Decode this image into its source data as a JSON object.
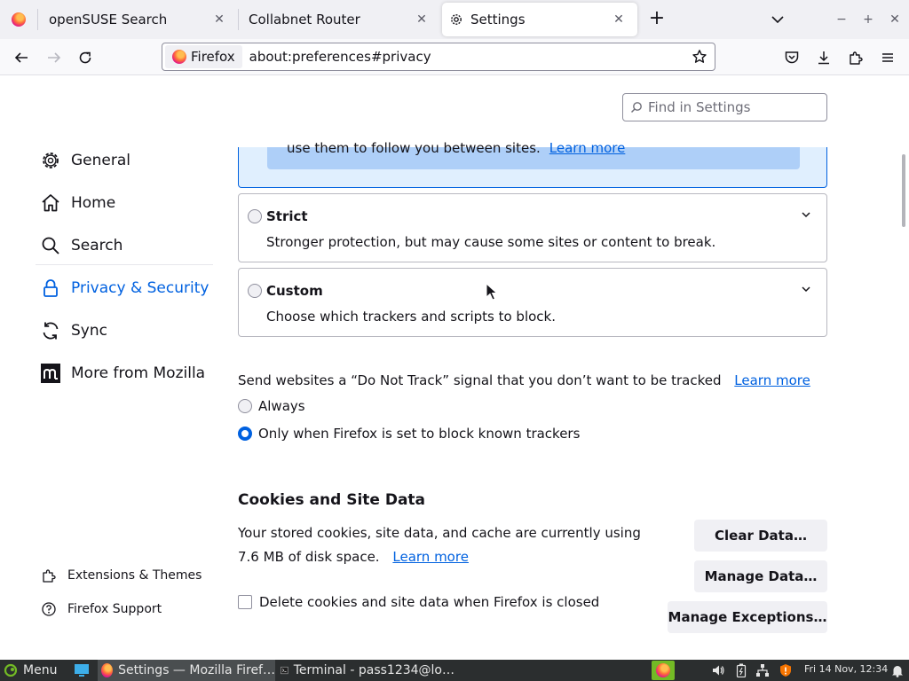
{
  "tabs": [
    {
      "title": "openSUSE Search",
      "active": false
    },
    {
      "title": "Collabnet Router",
      "active": false
    },
    {
      "title": "Settings",
      "active": true
    }
  ],
  "urlbar": {
    "identity": "Firefox",
    "url": "about:preferences#privacy"
  },
  "find": {
    "placeholder": "Find in Settings"
  },
  "sidebar": {
    "items": [
      {
        "label": "General",
        "icon": "gear-icon"
      },
      {
        "label": "Home",
        "icon": "home-icon"
      },
      {
        "label": "Search",
        "icon": "search-icon"
      },
      {
        "label": "Privacy & Security",
        "icon": "lock-icon",
        "selected": true
      },
      {
        "label": "Sync",
        "icon": "sync-icon"
      },
      {
        "label": "More from Mozilla",
        "icon": "mozilla-icon"
      }
    ],
    "footer": [
      {
        "label": "Extensions & Themes",
        "icon": "puzzle-icon"
      },
      {
        "label": "Firefox Support",
        "icon": "help-icon"
      }
    ]
  },
  "tracking": {
    "standard_tail": "use them to follow you between sites.",
    "learn_more": "Learn more",
    "strict": {
      "title": "Strict",
      "desc": "Stronger protection, but may cause some sites or content to break."
    },
    "custom": {
      "title": "Custom",
      "desc": "Choose which trackers and scripts to block."
    }
  },
  "dnt": {
    "label": "Send websites a “Do Not Track” signal that you don’t want to be tracked",
    "learn_more": "Learn more",
    "options": [
      {
        "label": "Always",
        "selected": false
      },
      {
        "label": "Only when Firefox is set to block known trackers",
        "selected": true
      }
    ]
  },
  "cookies": {
    "title": "Cookies and Site Data",
    "desc": "Your stored cookies, site data, and cache are currently using 7.6 MB of disk space.",
    "learn_more": "Learn more",
    "clear_btn": "Clear Data…",
    "manage_btn": "Manage Data…",
    "exceptions_btn": "Manage Exceptions…",
    "delete_on_close": "Delete cookies and site data when Firefox is closed"
  },
  "taskbar": {
    "menu": "Menu",
    "windows": [
      {
        "title": "Settings — Mozilla Firef…",
        "active": true
      },
      {
        "title": "Terminal - pass1234@lo…",
        "active": false
      }
    ],
    "clock": "Fri 14 Nov, 12:34"
  },
  "colors": {
    "accent": "#0061e0",
    "info_bg": "#e0effe",
    "taskbar": "#2b2e2f"
  }
}
